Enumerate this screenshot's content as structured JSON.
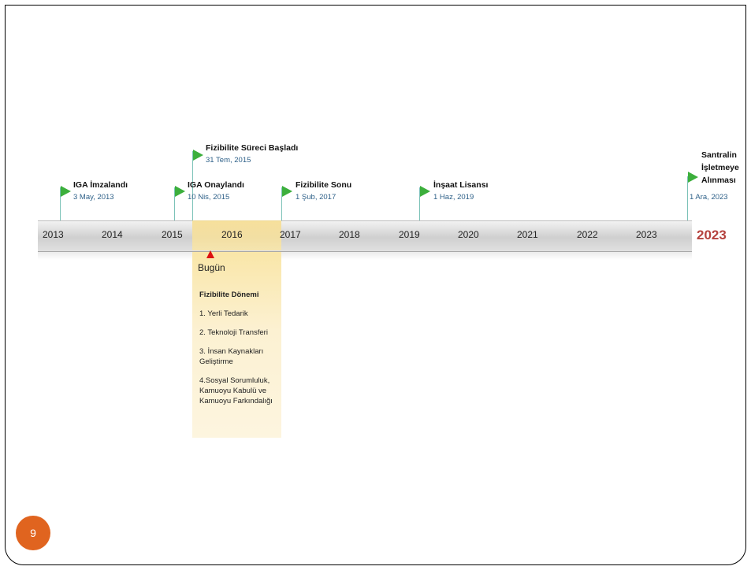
{
  "years": [
    "2013",
    "2014",
    "2015",
    "2016",
    "2017",
    "2018",
    "2019",
    "2020",
    "2021",
    "2022",
    "2023"
  ],
  "end_year": "2023",
  "milestones": [
    {
      "title": "IGA İmzalandı",
      "date": "3 May, 2013"
    },
    {
      "title": "Fizibilite Süreci Başladı",
      "date": "31 Tem, 2015"
    },
    {
      "title": "IGA Onaylandı",
      "date": "10 Nis, 2015"
    },
    {
      "title": "Fizibilite Sonu",
      "date": "1 Şub, 2017"
    },
    {
      "title": "İnşaat Lisansı",
      "date": "1 Haz, 2019"
    },
    {
      "title_lines": [
        "Santralin",
        "İşletmeye",
        "Alınması"
      ],
      "date": "1 Ara, 2023"
    }
  ],
  "today_label": "Bugün",
  "feasibility": {
    "heading": "Fizibilite  Dönemi",
    "items": [
      "1. Yerli Tedarik",
      "2. Teknoloji Transferi",
      "3. İnsan Kaynakları Geliştirme",
      "4.Sosyal Sorumluluk, Kamuoyu Kabulü ve Kamuoyu Farkındalığı"
    ]
  },
  "colors": {
    "flag": "#3caf3c",
    "end_year": "#b5423e",
    "badge": "#e0641f",
    "band": "#f9e6a8",
    "date": "#2f6189"
  },
  "page_number": "9"
}
